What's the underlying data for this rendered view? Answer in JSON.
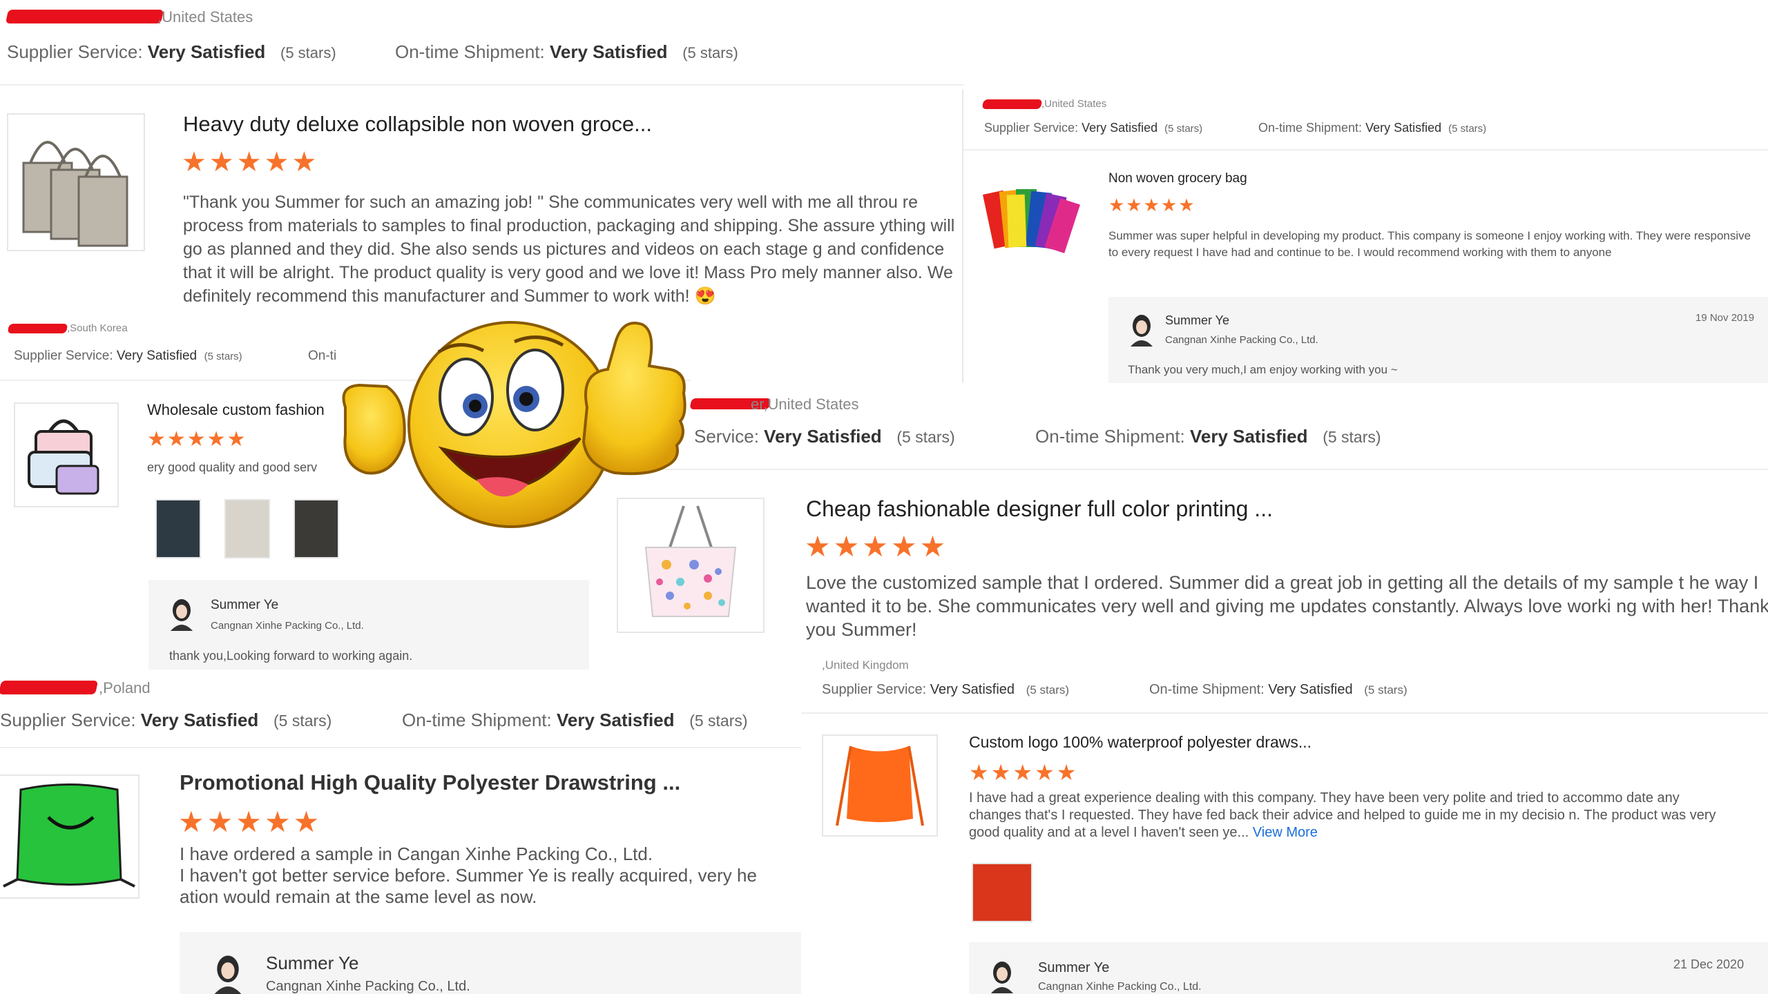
{
  "panel1": {
    "country": ",United States",
    "service_label": "Supplier Service:",
    "service_value": "Very Satisfied",
    "service_stars": "(5 stars)",
    "shipment_label": "On-time Shipment:",
    "shipment_value": "Very Satisfied",
    "shipment_stars": "(5 stars)",
    "product_title": "Heavy duty deluxe collapsible non woven groce...",
    "stars": "★★★★★",
    "review": "\"Thank you Summer for such an amazing job! \" She communicates very well with me all throu re process from materials to samples to final production, packaging and shipping. She assure ything will go as planned and they did. She also sends us pictures and videos on each stage g and confidence that it will be alright. The product quality is very good and we love it! Mass Pro mely manner also. We definitely recommend this manufacturer and Summer to work with! 😍"
  },
  "panel2": {
    "country": ",United States",
    "service_label": "Supplier Service:",
    "service_value": "Very Satisfied",
    "service_stars": "(5 stars)",
    "shipment_label": "On-time Shipment:",
    "shipment_value": "Very Satisfied",
    "shipment_stars": "(5 stars)",
    "product_title": "Non woven grocery bag",
    "stars": "★★★★★",
    "review": "Summer was super helpful in developing my product.  This company is someone I enjoy working with. They were responsive to every request I have had and continue to be.  I would recommend working with them to anyone",
    "reply_name": "Summer Ye",
    "reply_company": "Cangnan Xinhe Packing Co., Ltd.",
    "reply_date": "19 Nov 2019",
    "reply_text": "Thank you very much,I am enjoy working with you ~"
  },
  "panel3": {
    "country": ",South Korea",
    "service_label": "Supplier Service:",
    "service_value": "Very Satisfied",
    "service_stars": "(5 stars)",
    "shipment_label": "On-ti",
    "product_title": "Wholesale custom fashion",
    "stars": "★★★★★",
    "review": "ery good quality and good serv",
    "reply_name": "Summer Ye",
    "reply_company": "Cangnan Xinhe Packing Co., Ltd.",
    "reply_text": "thank you,Looking forward to working again."
  },
  "panel4": {
    "country": "er,United States",
    "service_label": "Service:",
    "service_value": "Very Satisfied",
    "service_stars": "(5 stars)",
    "shipment_label": "On-time Shipment:",
    "shipment_value": "Very Satisfied",
    "shipment_stars": "(5 stars)",
    "product_title": "Cheap fashionable designer full color printing ...",
    "stars": "★★★★★",
    "review": "Love the customized sample that I ordered. Summer did a great job in getting all the details of my sample t he way I wanted it to be. She communicates very well and giving me updates constantly. Always love worki ng with her! Thank you Summer!"
  },
  "panel5": {
    "country": ",Poland",
    "service_label": "Supplier Service:",
    "service_value": "Very Satisfied",
    "service_stars": "(5 stars)",
    "shipment_label": "On-time Shipment:",
    "shipment_value": "Very Satisfied",
    "shipment_stars": "(5 stars)",
    "product_title": "Promotional High Quality Polyester Drawstring ...",
    "stars": "★★★★★",
    "review_line1": "I have ordered a sample in Cangan Xinhe Packing Co., Ltd.",
    "review_line2": "I haven't got better service before. Summer Ye is really acquired, very he",
    "review_line3": "ation would remain at the same level as now.",
    "reply_name": "Summer Ye",
    "reply_company": "Cangnan Xinhe Packing Co., Ltd."
  },
  "panel6": {
    "country": ",United Kingdom",
    "service_label": "Supplier Service:",
    "service_value": "Very Satisfied",
    "service_stars": "(5 stars)",
    "shipment_label": "On-time Shipment:",
    "shipment_value": "Very Satisfied",
    "shipment_stars": "(5 stars)",
    "product_title": "Custom logo 100% waterproof polyester draws...",
    "stars": "★★★★★",
    "review": "I have had a great experience dealing with this company. They have been very polite and tried to accommo date any changes that's I requested. They have fed back their advice and helped to guide me in my decisio n. The product was very good quality and at a level I haven't seen ye...",
    "view_more": "View More",
    "reply_name": "Summer Ye",
    "reply_company": "Cangnan Xinhe Packing Co., Ltd.",
    "reply_date": "21 Dec 2020"
  },
  "colors": {
    "star": "#f7722a",
    "link": "#1a6ed8",
    "redaction": "#e8101c",
    "emoji": "#f5c518"
  },
  "icons": [
    "thumbs-up-emoji-icon",
    "avatar-icon"
  ]
}
